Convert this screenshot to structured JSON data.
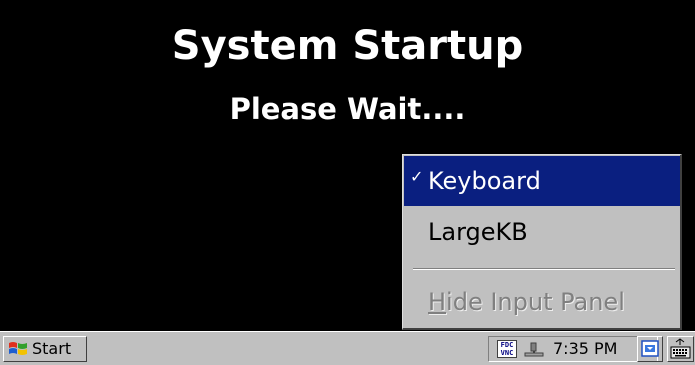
{
  "startup": {
    "title": "System Startup",
    "subtitle": "Please Wait...."
  },
  "input_menu": {
    "items": [
      {
        "label": "Keyboard",
        "checked": true,
        "selected": true,
        "enabled": true
      },
      {
        "label": "LargeKB",
        "checked": false,
        "selected": false,
        "enabled": true
      },
      {
        "label_underlined": "H",
        "label_rest": "ide Input Panel",
        "enabled": false
      }
    ],
    "check_mark": "✓"
  },
  "taskbar": {
    "start_label": "Start",
    "vnc_icon_text_top": "FDC",
    "vnc_icon_text_bottom": "VNC",
    "clock": "7:35 PM"
  },
  "colors": {
    "background": "#000000",
    "menu_face": "#c0c0c0",
    "selection": "#0a1f80",
    "disabled_text": "#808080"
  },
  "icons": {
    "start": "windows-logo-icon",
    "tray": [
      "vnc-icon",
      "network-icon"
    ],
    "desktop": "desktop-icon",
    "keyboard": "keyboard-icon"
  }
}
